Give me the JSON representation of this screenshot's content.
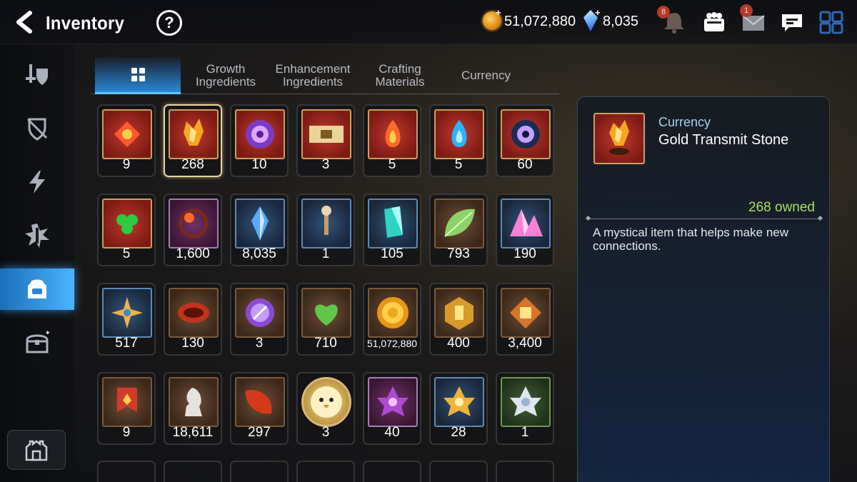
{
  "header": {
    "title": "Inventory",
    "help_label": "?",
    "gold": "51,072,880",
    "crystals": "8,035",
    "notification_badge": "8",
    "mail_badge": "1"
  },
  "sidebar": {
    "items": [
      {
        "name": "equipment",
        "active": false
      },
      {
        "name": "artifacts",
        "active": false
      },
      {
        "name": "catalysts",
        "active": false
      },
      {
        "name": "materials",
        "active": false
      },
      {
        "name": "items",
        "active": true
      },
      {
        "name": "chests",
        "active": false
      }
    ]
  },
  "tabs": [
    {
      "label": "",
      "icon": "grid-icon",
      "active": true
    },
    {
      "label": "Growth Ingredients",
      "active": false
    },
    {
      "label": "Enhancement Ingredients",
      "active": false
    },
    {
      "label": "Crafting Materials",
      "active": false
    },
    {
      "label": "Currency",
      "active": false
    }
  ],
  "items": [
    {
      "qty": "9",
      "frame": "red",
      "icon": "red-gem-icon"
    },
    {
      "qty": "268",
      "frame": "red",
      "icon": "gold-transmit-stone-icon",
      "selected": true
    },
    {
      "qty": "10",
      "frame": "red",
      "icon": "purple-disc-icon"
    },
    {
      "qty": "3",
      "frame": "red",
      "icon": "gold-ticket-icon"
    },
    {
      "qty": "5",
      "frame": "red",
      "icon": "fire-charm-icon"
    },
    {
      "qty": "5",
      "frame": "red",
      "icon": "water-charm-icon"
    },
    {
      "qty": "60",
      "frame": "red",
      "icon": "dark-disc-icon"
    },
    {
      "qty": "5",
      "frame": "red",
      "icon": "clover-charm-icon"
    },
    {
      "qty": "1,600",
      "frame": "purple",
      "icon": "flower-bracelet-icon"
    },
    {
      "qty": "8,035",
      "frame": "blue",
      "icon": "blue-crystal-icon"
    },
    {
      "qty": "1",
      "frame": "blue",
      "icon": "pendulum-icon"
    },
    {
      "qty": "105",
      "frame": "blue",
      "icon": "teal-crystal-icon"
    },
    {
      "qty": "793",
      "frame": "brown",
      "icon": "leaf-icon"
    },
    {
      "qty": "190",
      "frame": "blue",
      "icon": "pink-crystal-cluster-icon"
    },
    {
      "qty": "517",
      "frame": "blue",
      "icon": "star-charm-icon"
    },
    {
      "qty": "130",
      "frame": "brown",
      "icon": "red-cuff-icon"
    },
    {
      "qty": "3",
      "frame": "brown",
      "icon": "rune-seal-icon"
    },
    {
      "qty": "710",
      "frame": "brown",
      "icon": "green-heart-icon"
    },
    {
      "qty": "51,072,880",
      "frame": "brown",
      "icon": "gold-coin-icon",
      "small": true
    },
    {
      "qty": "400",
      "frame": "brown",
      "icon": "gold-emblem-icon"
    },
    {
      "qty": "3,400",
      "frame": "brown",
      "icon": "fist-emblem-icon"
    },
    {
      "qty": "9",
      "frame": "brown",
      "icon": "banner-icon"
    },
    {
      "qty": "18,611",
      "frame": "brown",
      "icon": "knight-piece-icon"
    },
    {
      "qty": "297",
      "frame": "brown",
      "icon": "red-leaf-icon"
    },
    {
      "qty": "3",
      "frame": "round",
      "icon": "chick-portrait-icon"
    },
    {
      "qty": "40",
      "frame": "purple",
      "icon": "purple-lotus-icon"
    },
    {
      "qty": "28",
      "frame": "blue",
      "icon": "gold-lotus-icon"
    },
    {
      "qty": "1",
      "frame": "green",
      "icon": "white-lotus-icon"
    }
  ],
  "detail": {
    "category": "Currency",
    "name": "Gold Transmit Stone",
    "owned": "268 owned",
    "description": "A mystical item that helps make new connections."
  },
  "colors": {
    "accent_blue": "#4ab4ff",
    "owned_green": "#a8e05a",
    "category_blue": "#9fd3f7",
    "selected_border": "#e7d7a2"
  }
}
